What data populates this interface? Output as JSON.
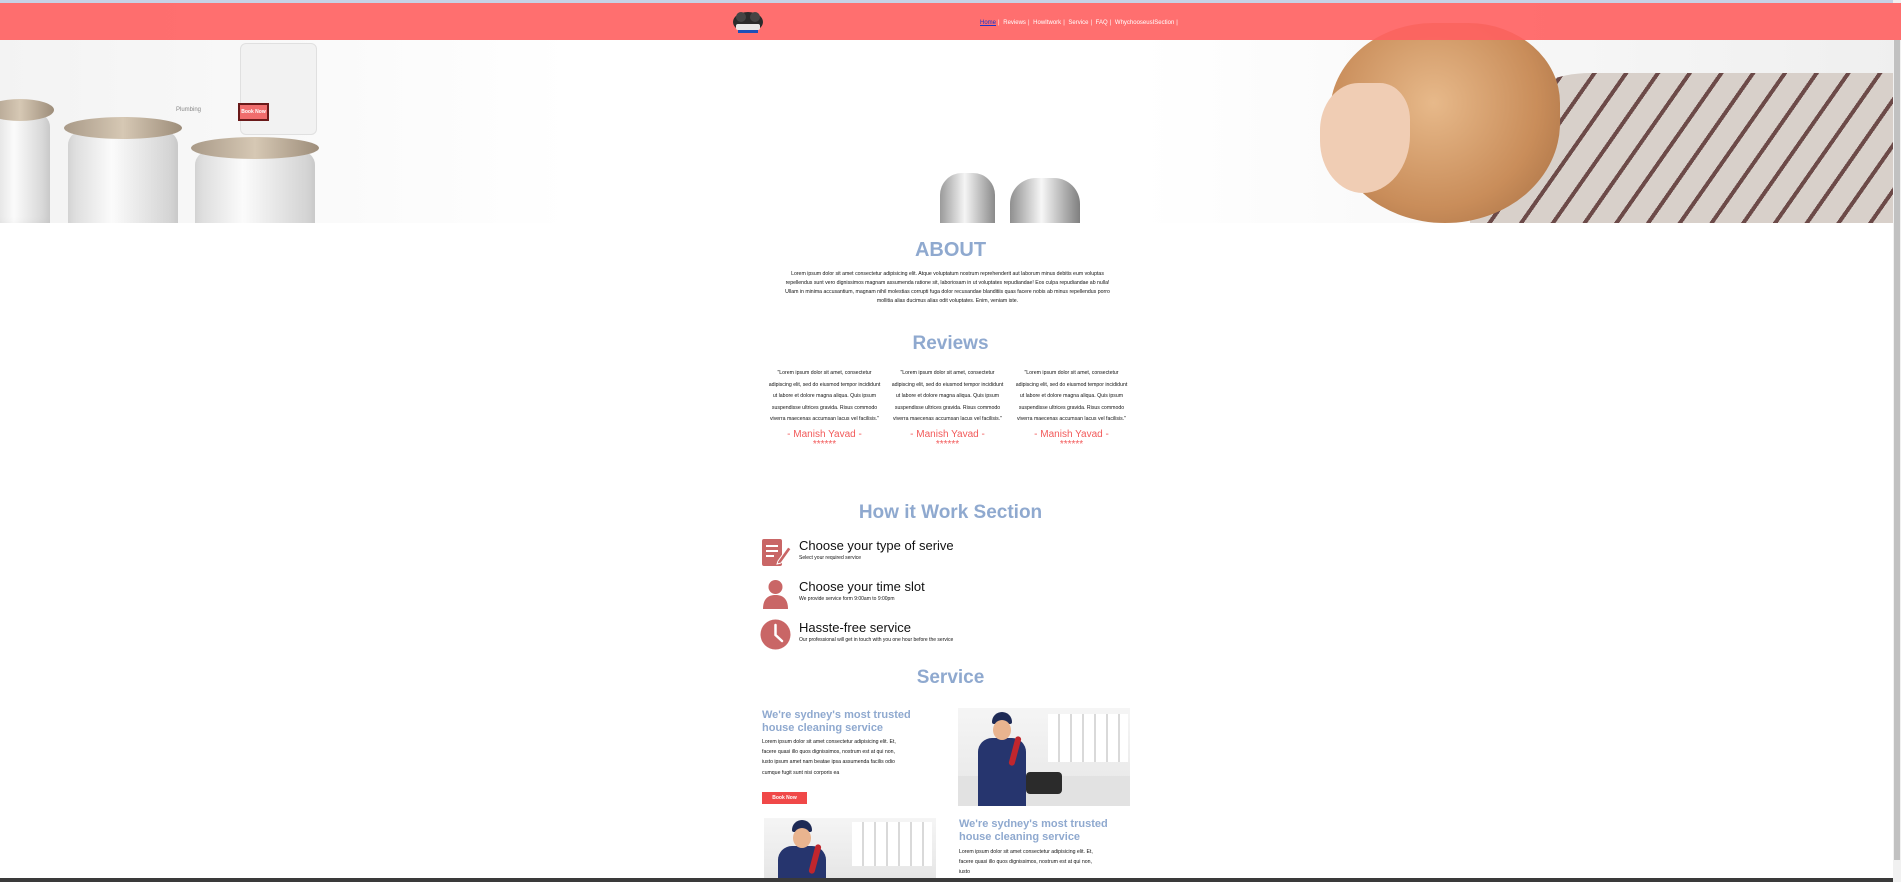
{
  "nav": {
    "logo_name": "plumber-logo",
    "items": [
      {
        "label": "Home",
        "active": true
      },
      {
        "label": "Reviews"
      },
      {
        "label": "HowItwork"
      },
      {
        "label": "Service"
      },
      {
        "label": "FAQ"
      },
      {
        "label": "WhychooseusISection"
      }
    ],
    "separator": "|"
  },
  "hero": {
    "search_text": "Plumbing",
    "book_now_label": "Book Now"
  },
  "about": {
    "title": "ABOUT",
    "text": "Lorem ipsum dolor sit amet consectetur adipisicing elit. Atque voluptatum nostrum reprehenderit aut laborum minus debitis eum voluptas repellendus sunt vero dignissimos magnam assumenda ratione sit, laboriosam in ut voluptates repudiandae! Eos culpa repudiandae ab nulla! Ullam in minima accusantium, magnam nihil molestias corrupti fuga dolor recusandae blanditiis quas facere nobis ab minus repellendus porro mollitia alias ducimus alias odit voluptates. Enim, veniam iste."
  },
  "reviews": {
    "title": "Reviews",
    "items": [
      {
        "text": "\"Lorem ipsum dolor sit amet, consectetur adipiscing elit, sed do eiusmod tempor incididunt ut labore et dolore magna aliqua. Quis ipsum suspendisse ultrices gravida. Risus commodo viverra maecenas accumsan lacus vel facilisis.\"",
        "name": "- Manish Yavad -",
        "stars": "******"
      },
      {
        "text": "\"Lorem ipsum dolor sit amet, consectetur adipiscing elit, sed do eiusmod tempor incididunt ut labore et dolore magna aliqua. Quis ipsum suspendisse ultrices gravida. Risus commodo viverra maecenas accumsan lacus vel facilisis.\"",
        "name": "- Manish Yavad -",
        "stars": "******"
      },
      {
        "text": "\"Lorem ipsum dolor sit amet, consectetur adipiscing elit, sed do eiusmod tempor incididunt ut labore et dolore magna aliqua. Quis ipsum suspendisse ultrices gravida. Risus commodo viverra maecenas accumsan lacus vel facilisis.\"",
        "name": "- Manish Yavad -",
        "stars": "******"
      }
    ]
  },
  "how": {
    "title": "How it Work Section",
    "steps": [
      {
        "icon": "document-edit-icon",
        "title": "Choose your type of serive",
        "subtitle": "Select your required service"
      },
      {
        "icon": "user-icon",
        "title": "Choose your time slot",
        "subtitle": "We provide service form 9:00am to 9:00pm"
      },
      {
        "icon": "clock-icon",
        "title": "Hasste-free service",
        "subtitle": "Our professional will get in touch with you one hour before the service"
      }
    ]
  },
  "service": {
    "title": "Service",
    "blocks": [
      {
        "heading": "We're sydney's most trusted house cleaning service",
        "text": "Lorem ipsum dolor sit amet consectetur adipisicing elit. Et, facere quasi illo quos dignissimos, nostrum est at qui non, iusto ipsum amet nam beatae ipsa assumenda facilis odio cumque fugit sunt nisi corporis ea",
        "button": "Book Now"
      },
      {
        "heading": "We're sydney's most trusted house cleaning service",
        "text": "Lorem ipsum dolor sit amet consectetur adipisicing elit. Et, facere quasi illo quos dignissimos, nostrum est at qui non, iusto"
      }
    ]
  },
  "colors": {
    "nav_bg": "#ff5f5f",
    "accent_title": "#8fa9cf",
    "reviewer": "#f25a5a",
    "button": "#f04848",
    "icon": "#c96666"
  }
}
